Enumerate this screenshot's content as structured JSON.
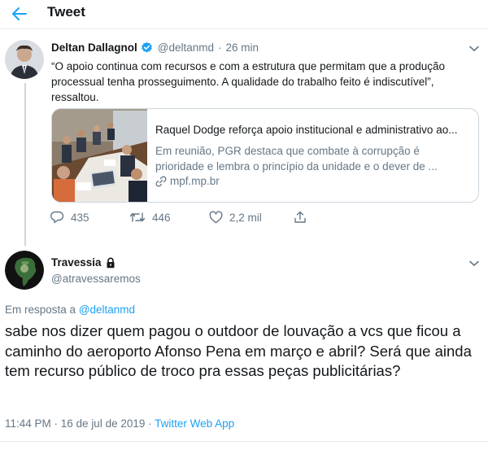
{
  "header": {
    "back_icon": "arrow-left-icon",
    "title": "Tweet"
  },
  "colors": {
    "accent": "#1da1f2",
    "text": "#14171a",
    "secondary": "#657786",
    "border": "#ccd6dd"
  },
  "original_tweet": {
    "avatar_icon": "avatar-photo",
    "display_name": "Deltan Dallagnol",
    "verified_icon": "verified-badge-icon",
    "handle": "@deltanmd",
    "separator": "·",
    "time": "26 min",
    "text": "“O apoio continua com recursos e com a estrutura que permitam que a produção processual tenha prosseguimento. A qualidade do trabalho feito é indiscutível”, ressaltou.",
    "card": {
      "title": "Raquel Dodge reforça apoio institucional e administrativo ao...",
      "description": "Em reunião, PGR destaca que combate à corrupção é prioridade e lembra o princípio da unidade e o dever de ...",
      "link_icon": "link-icon",
      "domain": "mpf.mp.br"
    },
    "actions": {
      "replies": "435",
      "retweets": "446",
      "likes": "2,2 mil"
    }
  },
  "reply_tweet": {
    "avatar_icon": "travessia-logo",
    "display_name": "Travessia",
    "lock_icon": "lock-icon",
    "handle": "@atravessaremos",
    "reply_to_prefix": "Em resposta a",
    "reply_to_handle": "@deltanmd",
    "text": "sabe nos dizer quem pagou o outdoor de louvação a vcs que ficou a caminho do aeroporto Afonso Pena em março e abril? Será que ainda tem recurso público de troco pra essas peças publicitárias?",
    "timestamp": "11:44 PM · 16 de jul de 2019 ·",
    "source": "Twitter Web App"
  }
}
